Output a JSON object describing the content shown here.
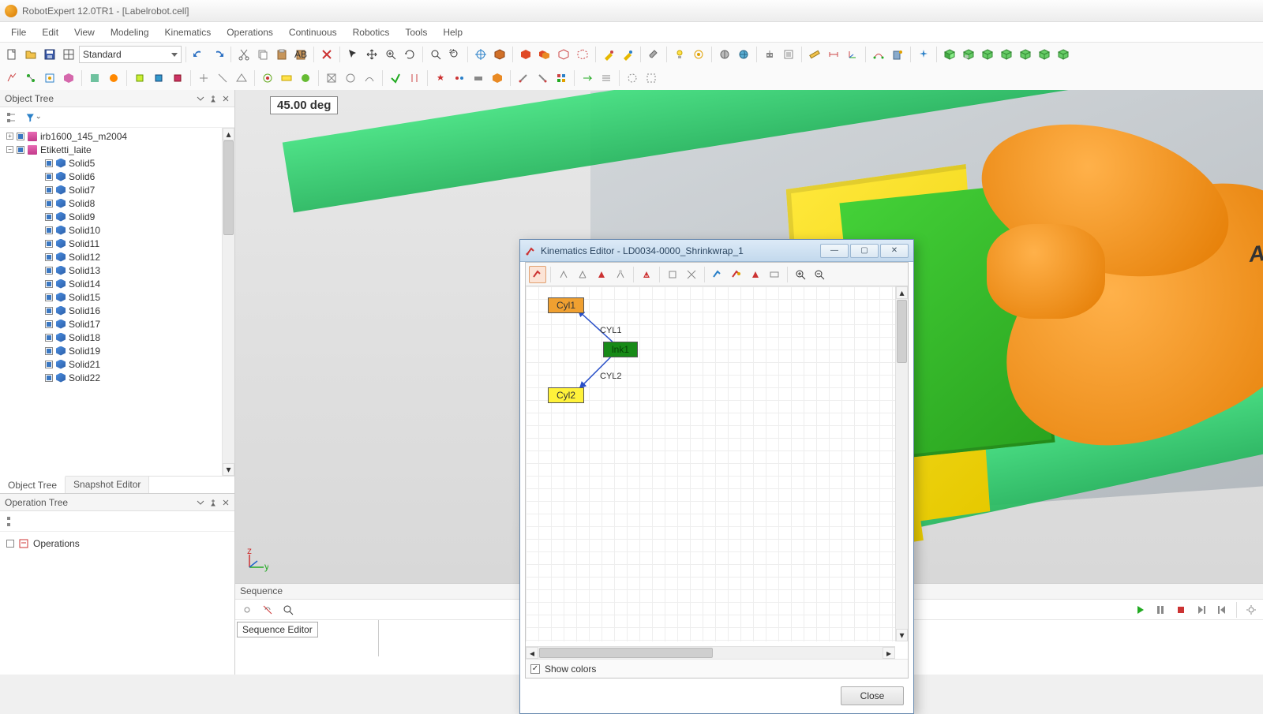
{
  "title": "RobotExpert 12.0TR1 - [Labelrobot.cell]",
  "menus": [
    "File",
    "Edit",
    "View",
    "Modeling",
    "Kinematics",
    "Operations",
    "Continuous",
    "Robotics",
    "Tools",
    "Help"
  ],
  "toolbar_preset": "Standard",
  "viewport": {
    "angle_label": "45.00 deg",
    "robot_brand": "ABB"
  },
  "object_tree": {
    "title": "Object Tree",
    "tabs": [
      "Object Tree",
      "Snapshot Editor"
    ],
    "active_tab": 0,
    "nodes": {
      "robot": "irb1600_145_m2004",
      "device": "Etiketti_laite",
      "solids": [
        "Solid5",
        "Solid6",
        "Solid7",
        "Solid8",
        "Solid9",
        "Solid10",
        "Solid11",
        "Solid12",
        "Solid13",
        "Solid14",
        "Solid15",
        "Solid16",
        "Solid17",
        "Solid18",
        "Solid19",
        "Solid21",
        "Solid22"
      ]
    }
  },
  "operation_tree": {
    "title": "Operation Tree",
    "root": "Operations"
  },
  "sequence_editor": {
    "dock_title": "Sequence",
    "panel_title": "Sequence Editor"
  },
  "kin_dialog": {
    "title": "Kinematics Editor -  LD0034-0000_Shrinkwrap_1",
    "show_colors_label": "Show colors",
    "show_colors_checked": true,
    "close_label": "Close",
    "nodes": {
      "cyl1": "Cyl1",
      "link": "lnk1",
      "cyl2": "Cyl2",
      "joint1": "CYL1",
      "joint2": "CYL2"
    }
  }
}
